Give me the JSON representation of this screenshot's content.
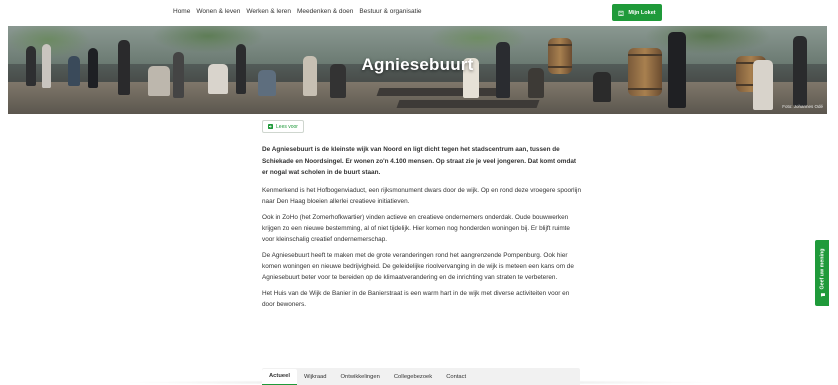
{
  "nav": {
    "items": [
      "Home",
      "Wonen & leven",
      "Werken & leren",
      "Meedenken & doen",
      "Bestuur & organisatie"
    ],
    "loket_button": "Mijn Loket"
  },
  "hero": {
    "title": "Agniesebuurt",
    "credit": "Foto: Johannes Odé"
  },
  "read_aloud": "Lees voor",
  "article": {
    "intro": "De Agniesebuurt is de kleinste wijk van Noord en ligt dicht tegen het stadscentrum aan, tussen de Schiekade en Noordsingel. Er wonen zo'n 4.100 mensen. Op straat zie je veel jongeren. Dat komt omdat er nogal wat scholen in de buurt staan.",
    "paragraphs": [
      "Kenmerkend is het Hofbogenviaduct, een rijksmonument dwars door de wijk. Op en rond deze vroegere spoorlijn naar Den Haag bloeien allerlei creatieve initiatieven.",
      "Ook in ZoHo (het Zomerhofkwartier) vinden actieve en creatieve ondernemers onderdak. Oude bouwwerken krijgen zo een nieuwe bestemming, al of niet tijdelijk. Hier komen nog honderden woningen bij. Er blijft ruimte voor kleinschalig creatief ondernemerschap.",
      "De Agniesebuurt heeft te maken met de grote veranderingen rond het aangrenzende Pompenburg. Ook hier komen woningen en nieuwe bedrijvigheid. De geleidelijke rioolvervanging in de wijk is meteen een kans om de Agniesebuurt beter voor te bereiden op de klimaatverandering en de inrichting van straten te verbeteren.",
      "Het Huis van de Wijk de Banier in de Banierstraat is een warm hart in de wijk met diverse activiteiten voor en door bewoners."
    ]
  },
  "tabs": [
    "Actueel",
    "Wijkraad",
    "Ontwikkelingen",
    "Collegebezoek",
    "Contact"
  ],
  "feedback": "Geef uw mening",
  "colors": {
    "brand_green": "#1f9a3a",
    "text": "#333333"
  }
}
